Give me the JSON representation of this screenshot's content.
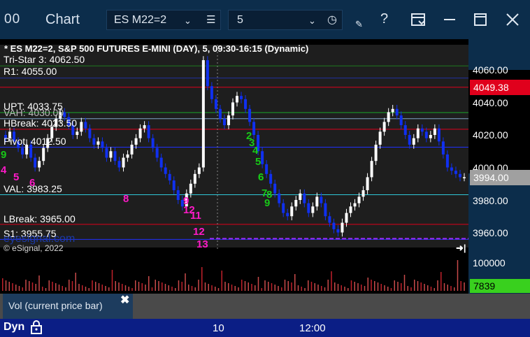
{
  "window": {
    "title": "Chart",
    "app_icon": "00",
    "symbol": "ES M22=2",
    "interval": "5",
    "icons": [
      "chevron-down-icon",
      "menu-icon",
      "clock-icon",
      "pencil-icon",
      "help-icon",
      "template-icon",
      "minimize-icon",
      "maximize-icon",
      "close-icon"
    ],
    "help_glyph": "?"
  },
  "chart": {
    "header": "* ES M22=2, S&P 500 FUTURES E-MINI (DAY), 5, 09:30-16:15 (Dynamic)",
    "copyright": "© eSignal, 2022",
    "watermark": "eyesignal.com",
    "levels": {
      "tristar3": "Tri-Star 3: 4062.50",
      "r1": "R1: 4055.00",
      "upt": "UPT: 4033.75",
      "vah": "VAH: 4030.00",
      "hbreak": "HBreak: 4023.50",
      "pivot": "Pivot: 4012.50",
      "val": "VAL: 3983.25",
      "lbreak": "LBreak: 3965.00",
      "s1": "S1: 3955.75"
    },
    "price_axis": [
      "4060.00",
      "4040.00",
      "4020.00",
      "4000.00",
      "3980.00",
      "3960.00"
    ],
    "flags": {
      "r1_price": "4049.38",
      "last_price": "3994.00",
      "volume": "7839"
    },
    "volume_axis": "100000",
    "time_axis": [
      "10",
      "12:00"
    ],
    "td_counts": {
      "magenta": [
        "4",
        "5",
        "6",
        "8",
        "9",
        "12",
        "11",
        "12",
        "13"
      ],
      "green": [
        "9",
        "2",
        "3",
        "4",
        "5",
        "6",
        "7",
        "8",
        "9",
        "6"
      ]
    },
    "colors": {
      "up": "#ffffff",
      "down": "#1030f0",
      "r1_line": "#e0001c",
      "s1_line": "#9a2bff",
      "pivot_line": "#2030ff",
      "value_line": "#30c8d8",
      "td_magenta": "#ff1ac8",
      "td_green": "#18c818",
      "vol_green": "#39d01e"
    }
  },
  "legend": {
    "label": "Vol (current price bar)",
    "close_glyph": "✖"
  },
  "bottom_bar": {
    "mode": "Dyn"
  }
}
